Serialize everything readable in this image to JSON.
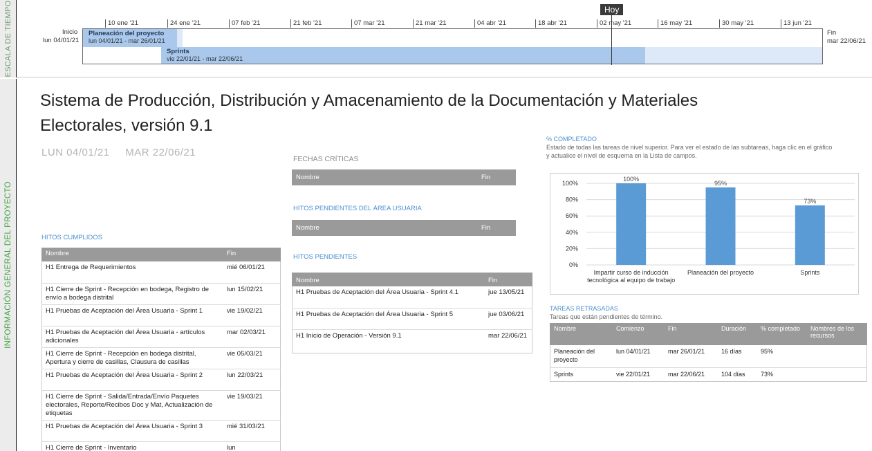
{
  "timeline": {
    "side_label": "ESCALA DE TIEMPO",
    "today_label": "Hoy",
    "ticks": [
      "10 ene '21",
      "24 ene '21",
      "07 feb '21",
      "21 feb '21",
      "07 mar '21",
      "21 mar '21",
      "04 abr '21",
      "18 abr '21",
      "02 may '21",
      "16 may '21",
      "30 may '21",
      "13 jun '21"
    ],
    "start_label": "Inicio",
    "start_date": "lun 04/01/21",
    "end_label": "Fin",
    "end_date": "mar 22/06/21",
    "bars": [
      {
        "title": "Planeación del proyecto",
        "dates": "lun 04/01/21 - mar 26/01/21"
      },
      {
        "title": "Sprints",
        "dates": "vie 22/01/21 - mar 22/06/21"
      }
    ]
  },
  "info": {
    "side_label": "INFORMACIÓN GENERAL DEL PROYECTO",
    "title": "Sistema de Producción, Distribución y Amacenamiento de la Documentación y Materiales Electorales, versión 9.1",
    "start": "LUN 04/01/21",
    "finish": "MAR 22/06/21"
  },
  "hitos_cumplidos": {
    "title": "HITOS CUMPLIDOS",
    "headers": [
      "Nombre",
      "Fin"
    ],
    "rows": [
      [
        "H1 Entrega de Requerimientos",
        "mié 06/01/21"
      ],
      [
        "H1 Cierre de Sprint - Recepción en bodega, Registro de envío a bodega distrital",
        "lun 15/02/21"
      ],
      [
        "H1 Pruebas de Aceptación del Área Usuaria - Sprint 1",
        "vie 19/02/21"
      ],
      [
        "H1 Pruebas de Aceptación del Área Usuaria - artículos adicionales",
        "mar 02/03/21"
      ],
      [
        "H1 Cierre de Sprint - Recepción en bodega distrital, Apertura y cierre de casillas, Clausura de casillas",
        "vie 05/03/21"
      ],
      [
        "H1 Pruebas de Aceptación del Área Usuaria - Sprint 2",
        "lun 22/03/21"
      ],
      [
        "H1 Cierre de Sprint - Salida/Entrada/Envío Paquetes electorales, Reporte/Recibos Doc y Mat, Actualización de etiquetas",
        "vie 19/03/21"
      ],
      [
        "H1 Pruebas de Aceptación del Área Usuaria - Sprint 3",
        "mié 31/03/21"
      ],
      [
        "H1 Cierre de Sprint - Inventario",
        "lun"
      ]
    ]
  },
  "fechas_criticas": {
    "title": "FECHAS CRÍTICAS",
    "headers": [
      "Nombre",
      "Fin"
    ]
  },
  "hitos_area_usuaria": {
    "title": "HITOS PENDIENTES DEL ÁREA USUARIA",
    "headers": [
      "Nombre",
      "Fin"
    ]
  },
  "hitos_pendientes": {
    "title": "HITOS PENDIENTES",
    "headers": [
      "Nombre",
      "Fin"
    ],
    "rows": [
      [
        "H1 Pruebas de Aceptación del Área Usuaria - Sprint 4.1",
        "jue 13/05/21"
      ],
      [
        "H1 Pruebas de Aceptación del Área Usuaria - Sprint 5",
        "jue 03/06/21"
      ],
      [
        "H1 Inicio de Operación - Versión 9.1",
        "mar 22/06/21"
      ]
    ]
  },
  "completado": {
    "title": "% COMPLETADO",
    "subtitle": "Estado de todas las tareas de nivel superior. Para ver el estado de las subtareas, haga clic en el gráfico y actualice el nivel de esquema en la Lista de campos."
  },
  "chart_data": {
    "type": "bar",
    "categories": [
      "Impartir curso de inducción tecnológica al equipo de trabajo",
      "Planeación del proyecto",
      "Sprints"
    ],
    "values": [
      100,
      95,
      73
    ],
    "data_labels": [
      "100%",
      "95%",
      "73%"
    ],
    "yticks": [
      "0%",
      "20%",
      "40%",
      "60%",
      "80%",
      "100%"
    ],
    "ylim": [
      0,
      100
    ],
    "bar_color": "#5b9bd5",
    "grid": true,
    "legend": "none"
  },
  "tareas_retrasadas": {
    "title": "TAREAS RETRASADAS",
    "subtitle": "Tareas que están pendientes de término.",
    "headers": [
      "Nombre",
      "Comienzo",
      "Fin",
      "Duración",
      "% completado",
      "Nombres de los recursos"
    ],
    "rows": [
      [
        "Planeación del proyecto",
        "lun 04/01/21",
        "mar 26/01/21",
        "16 días",
        "95%",
        ""
      ],
      [
        "Sprints",
        "vie 22/01/21",
        "mar 22/06/21",
        "104 días",
        "73%",
        ""
      ]
    ]
  }
}
